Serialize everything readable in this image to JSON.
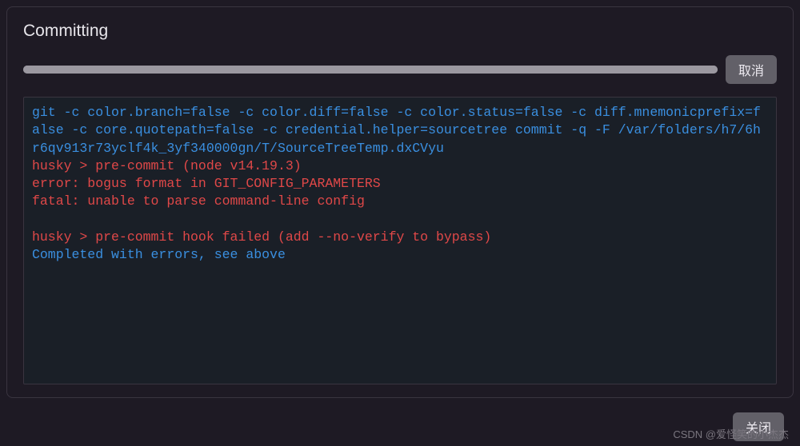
{
  "dialog": {
    "title": "Committing",
    "cancel_label": "取消",
    "close_label": "关闭",
    "progress_percent": 100
  },
  "console": {
    "lines": [
      {
        "text": "git -c color.branch=false -c color.diff=false -c color.status=false -c diff.mnemonicprefix=false -c core.quotepath=false -c credential.helper=sourcetree commit -q -F /var/folders/h7/6hr6qv913r73yclf4k_3yf340000gn/T/SourceTreeTemp.dxCVyu",
        "color": "blue"
      },
      {
        "text": "husky > pre-commit (node v14.19.3)",
        "color": "red"
      },
      {
        "text": "error: bogus format in GIT_CONFIG_PARAMETERS",
        "color": "red"
      },
      {
        "text": "fatal: unable to parse command-line config",
        "color": "red"
      },
      {
        "text": "",
        "color": "red"
      },
      {
        "text": "husky > pre-commit hook failed (add --no-verify to bypass)",
        "color": "red"
      },
      {
        "text": "Completed with errors, see above",
        "color": "blue"
      }
    ]
  },
  "watermark": "CSDN @爱怪笑的小杰杰"
}
